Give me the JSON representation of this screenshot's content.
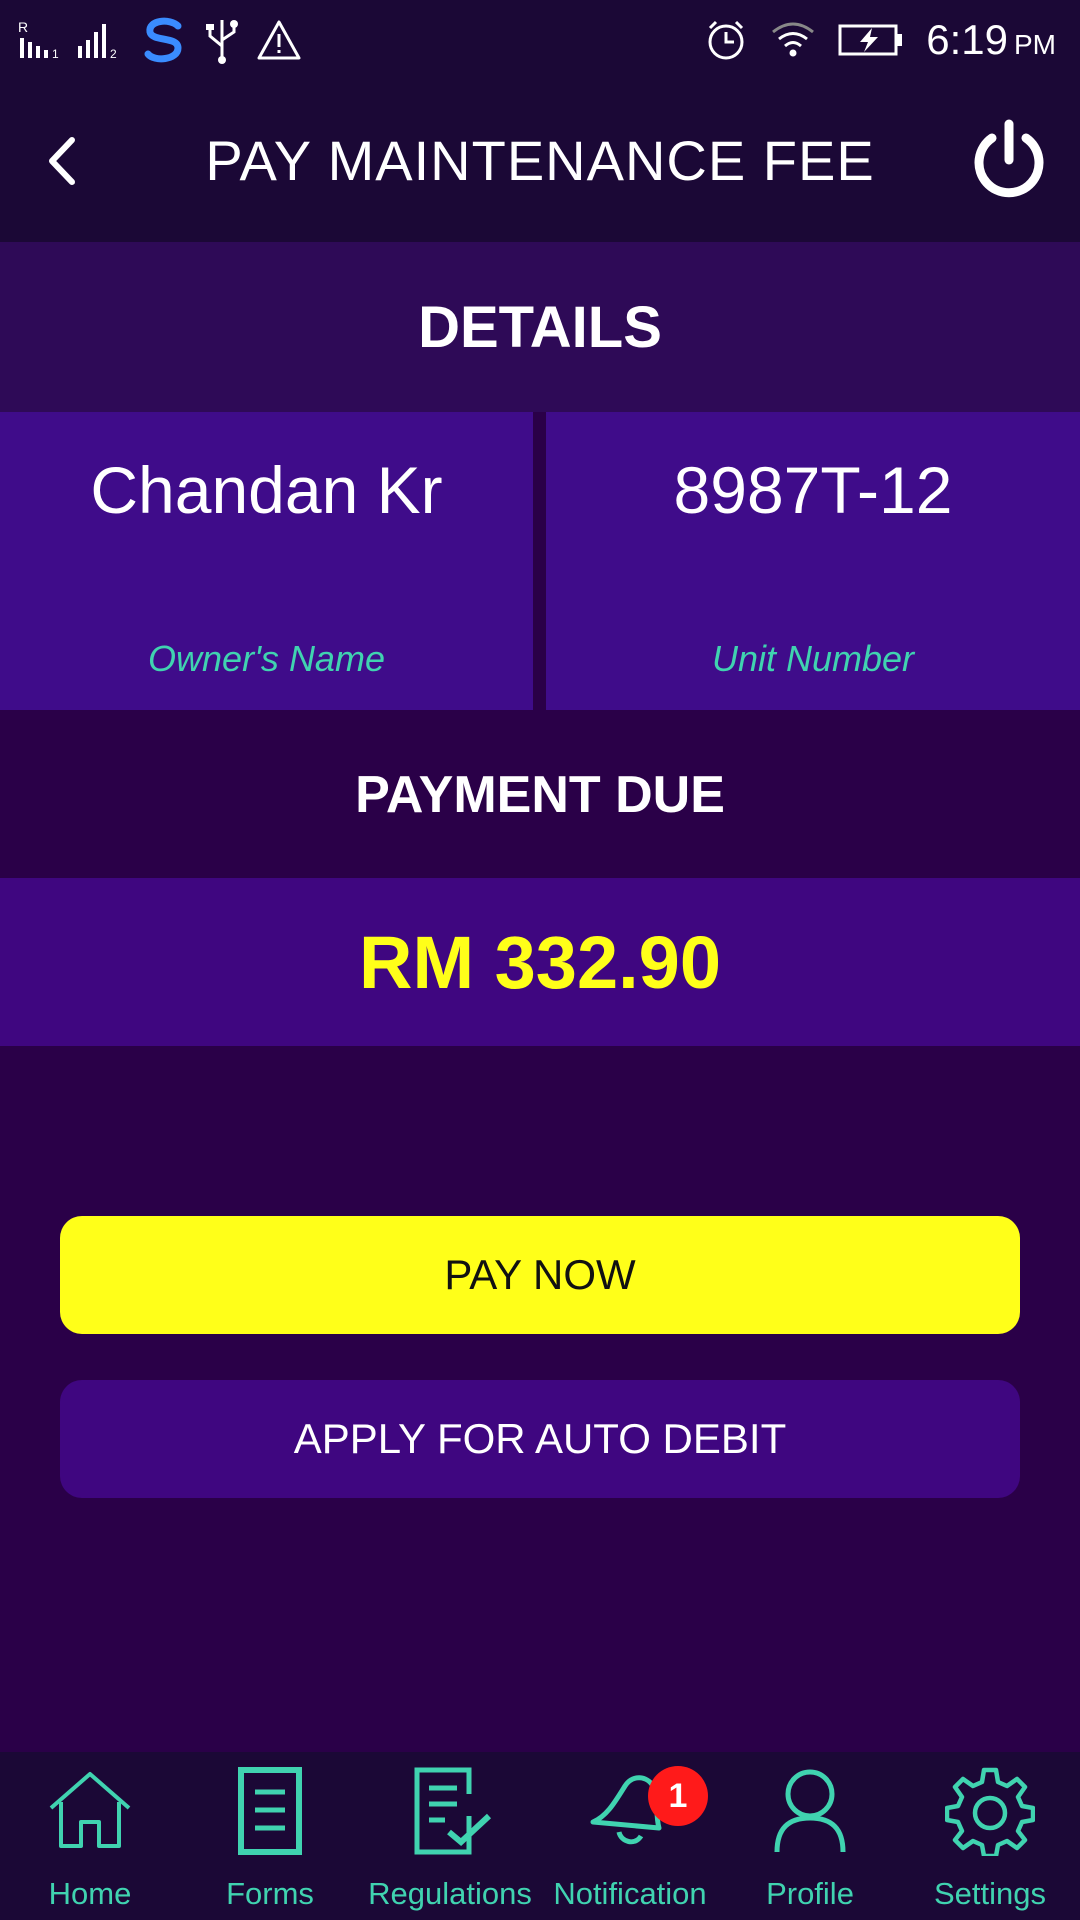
{
  "status_bar": {
    "time": "6:19",
    "ampm": "PM",
    "icons": [
      "roaming-signal-icon",
      "signal-sim2-icon",
      "s-app-icon",
      "usb-icon",
      "warning-icon",
      "alarm-icon",
      "wifi-icon",
      "battery-charging-icon"
    ]
  },
  "header": {
    "title": "PAY MAINTENANCE FEE",
    "back_icon": "chevron-left-icon",
    "power_icon": "power-icon"
  },
  "details": {
    "title": "DETAILS",
    "owner_name": "Chandan Kr",
    "owner_label": "Owner's Name",
    "unit_number": "8987T-12",
    "unit_label": "Unit Number"
  },
  "payment": {
    "title": "PAYMENT DUE",
    "amount": "RM 332.90"
  },
  "actions": {
    "pay_now": "PAY NOW",
    "auto_debit": "APPLY FOR AUTO DEBIT"
  },
  "nav": {
    "items": [
      {
        "label": "Home",
        "icon": "home-icon"
      },
      {
        "label": "Forms",
        "icon": "forms-icon"
      },
      {
        "label": "Regulations",
        "icon": "regulations-icon"
      },
      {
        "label": "Notification",
        "icon": "bell-icon",
        "badge": "1"
      },
      {
        "label": "Profile",
        "icon": "profile-icon"
      },
      {
        "label": "Settings",
        "icon": "settings-icon"
      }
    ]
  },
  "colors": {
    "accent": "#40d3b0",
    "highlight": "#ffff19",
    "badge": "#ff1a1a"
  }
}
